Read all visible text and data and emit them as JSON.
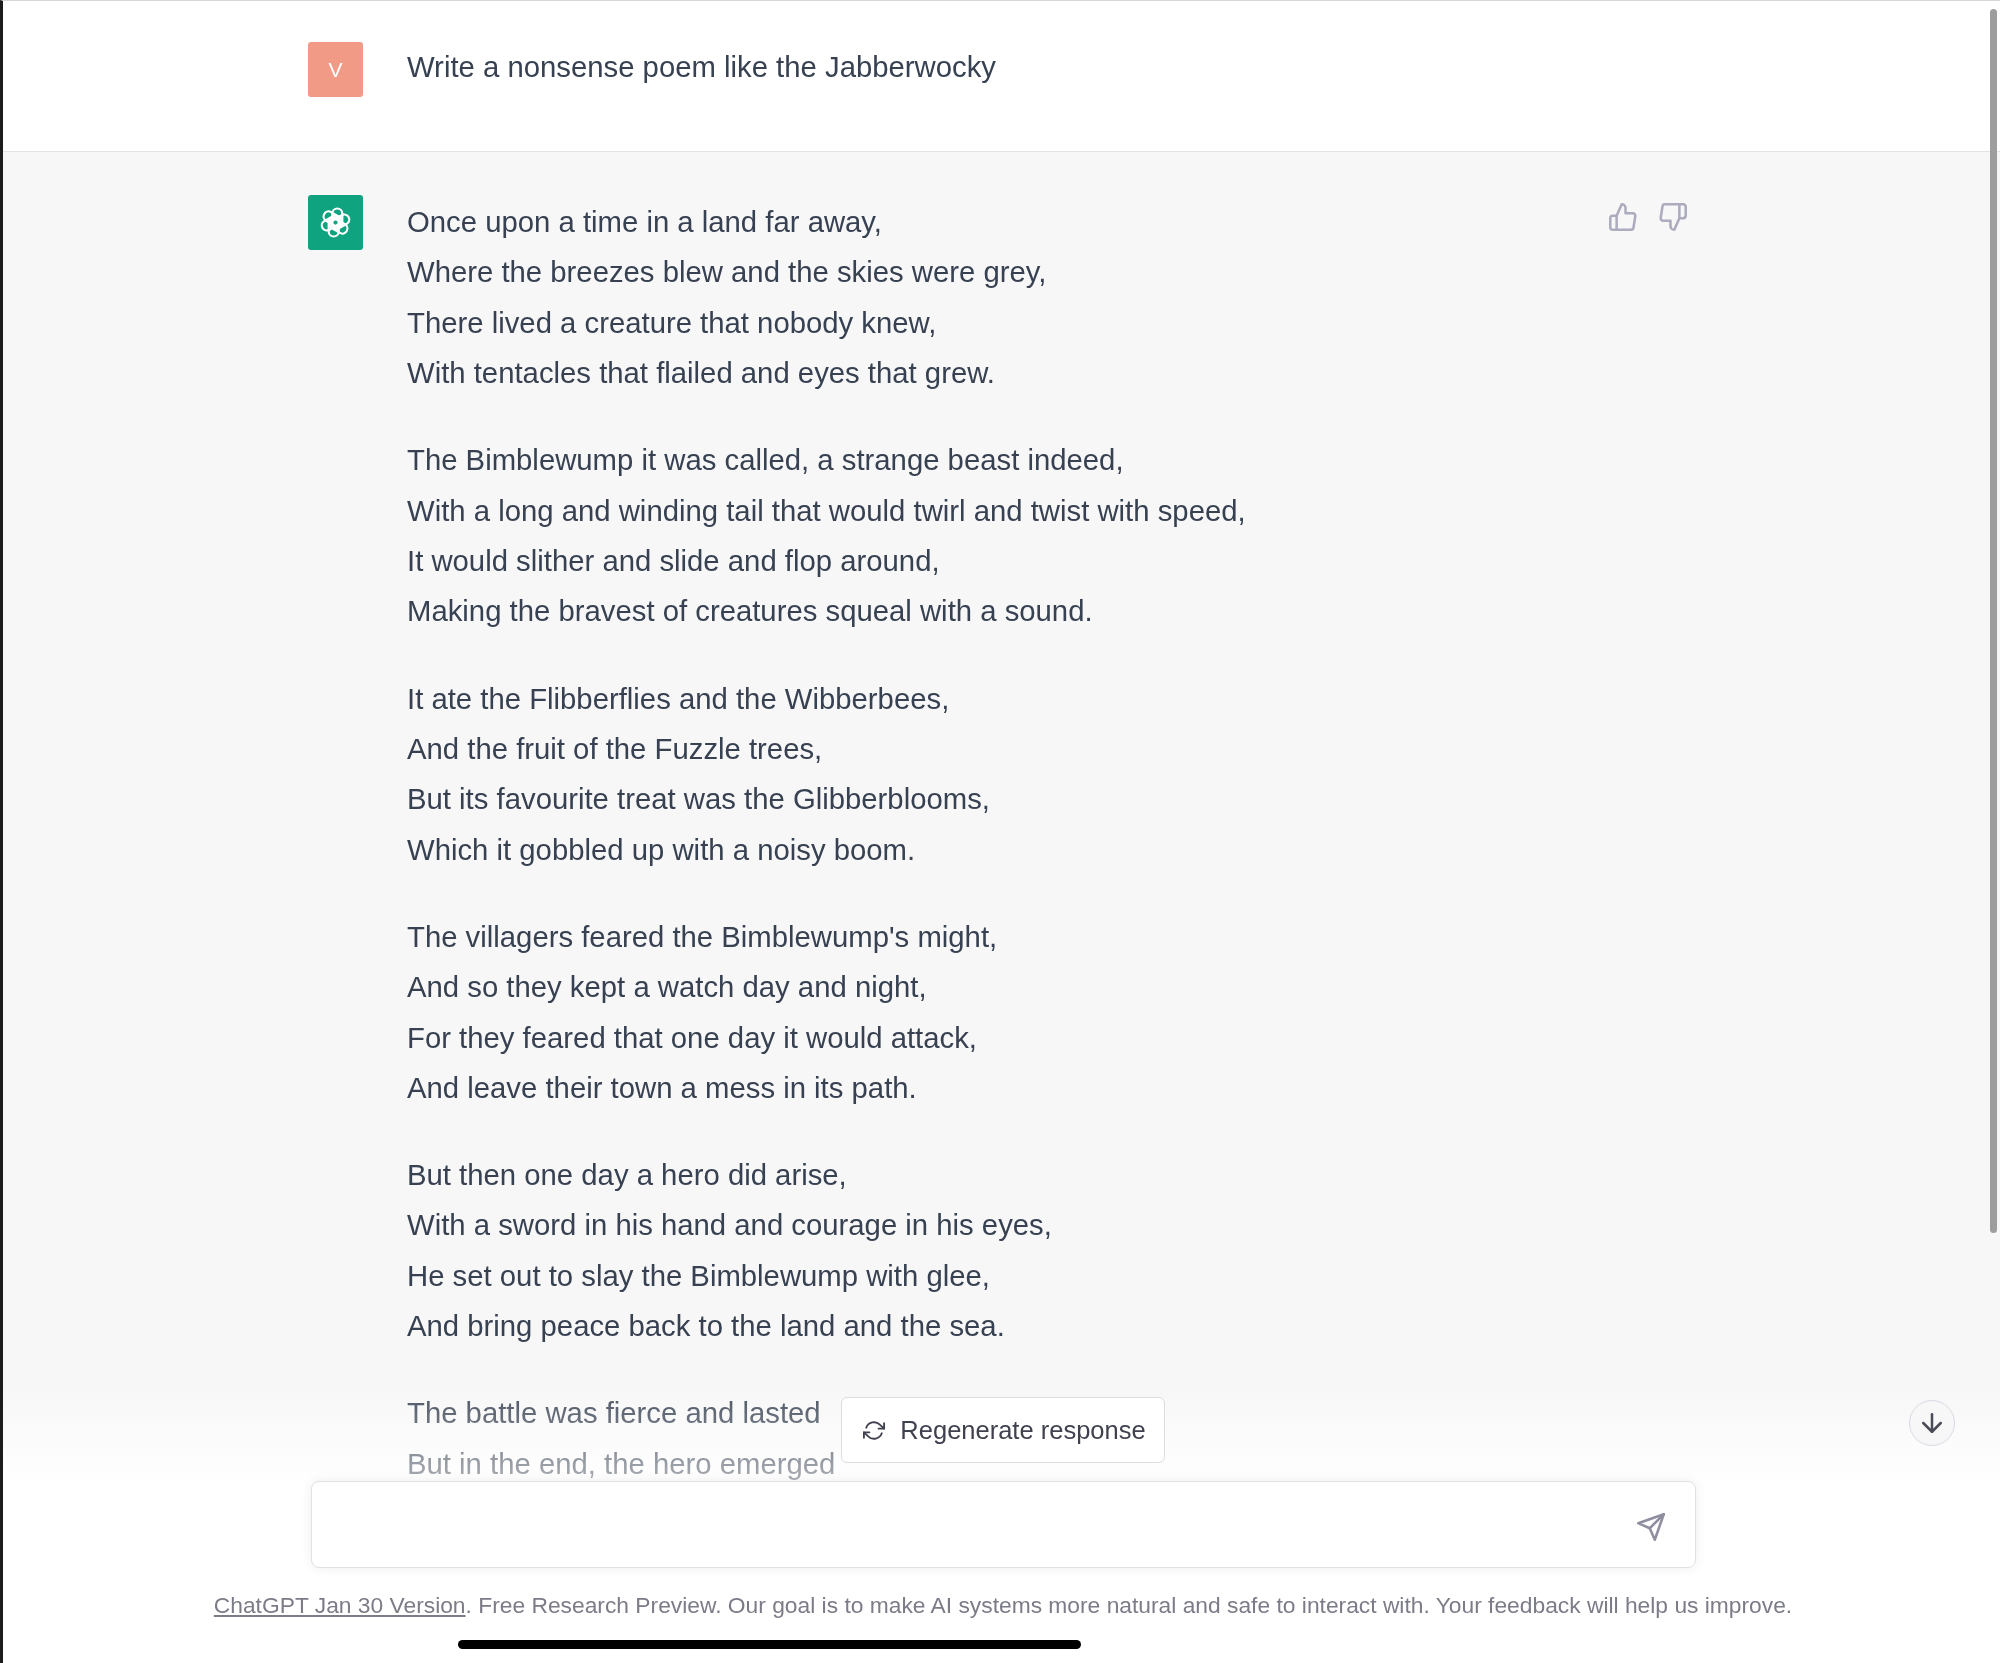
{
  "user_message": {
    "avatar_letter": "V",
    "text": "Write a nonsense poem like the Jabberwocky"
  },
  "assistant_message": {
    "stanzas": [
      {
        "lines": [
          "Once upon a time in a land far away,",
          "Where the breezes blew and the skies were grey,",
          "There lived a creature that nobody knew,",
          "With tentacles that flailed and eyes that grew."
        ]
      },
      {
        "lines": [
          "The Bimblewump it was called, a strange beast indeed,",
          "With a long and winding tail that would twirl and twist with speed,",
          "It would slither and slide and flop around,",
          "Making the bravest of creatures squeal with a sound."
        ]
      },
      {
        "lines": [
          "It ate the Flibberflies and the Wibberbees,",
          "And the fruit of the Fuzzle trees,",
          "But its favourite treat was the Glibberblooms,",
          "Which it gobbled up with a noisy boom."
        ]
      },
      {
        "lines": [
          "The villagers feared the Bimblewump's might,",
          "And so they kept a watch day and night,",
          "For they feared that one day it would attack,",
          "And leave their town a mess in its path."
        ]
      },
      {
        "lines": [
          "But then one day a hero did arise,",
          "With a sword in his hand and courage in his eyes,",
          "He set out to slay the Bimblewump with glee,",
          "And bring peace back to the land and the sea."
        ]
      },
      {
        "lines": [
          "The battle was fierce and lasted",
          "But in the end, the hero emerged"
        ]
      }
    ]
  },
  "regenerate_button": {
    "label": "Regenerate response"
  },
  "footer": {
    "link": "ChatGPT Jan 30 Version",
    "text": ". Free Research Preview. Our goal is to make AI systems more natural and safe to interact with. Your feedback will help us improve."
  }
}
